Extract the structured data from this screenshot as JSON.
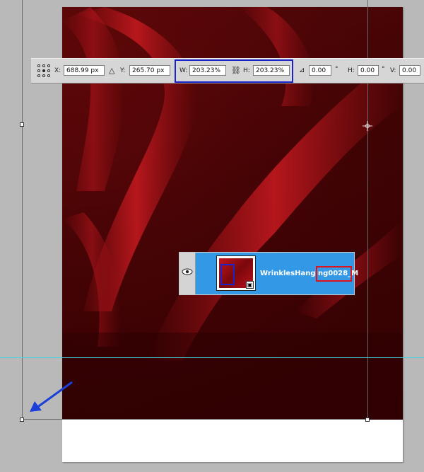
{
  "options_bar": {
    "x_label": "X:",
    "x_value": "688.99 px",
    "y_label": "Y:",
    "y_value": "265.70 px",
    "w_label": "W:",
    "w_value": "203.23%",
    "h_label": "H:",
    "h_value": "203.23%",
    "rotate_value": "0.00",
    "degree_sign": "°",
    "hskew_label": "H:",
    "hskew_value": "0.00",
    "vskew_label": "V:",
    "vskew_value": "0.00"
  },
  "layer": {
    "name": "WrinklesHanging0028_M"
  },
  "colors": {
    "annotation_blue": "#1c24c8",
    "annotation_red": "#e0121c",
    "guide": "#44d6dc",
    "layer_selected": "#3398e6"
  },
  "icons": {
    "reference_point": "reference-point-grid-icon",
    "delta": "delta-triangle-icon",
    "link": "link-chain-icon",
    "angle": "rotate-angle-icon",
    "eye": "eye-icon",
    "smart_object": "smart-object-icon",
    "crosshair": "center-crosshair-icon",
    "arrow": "annotation-arrow-icon"
  }
}
